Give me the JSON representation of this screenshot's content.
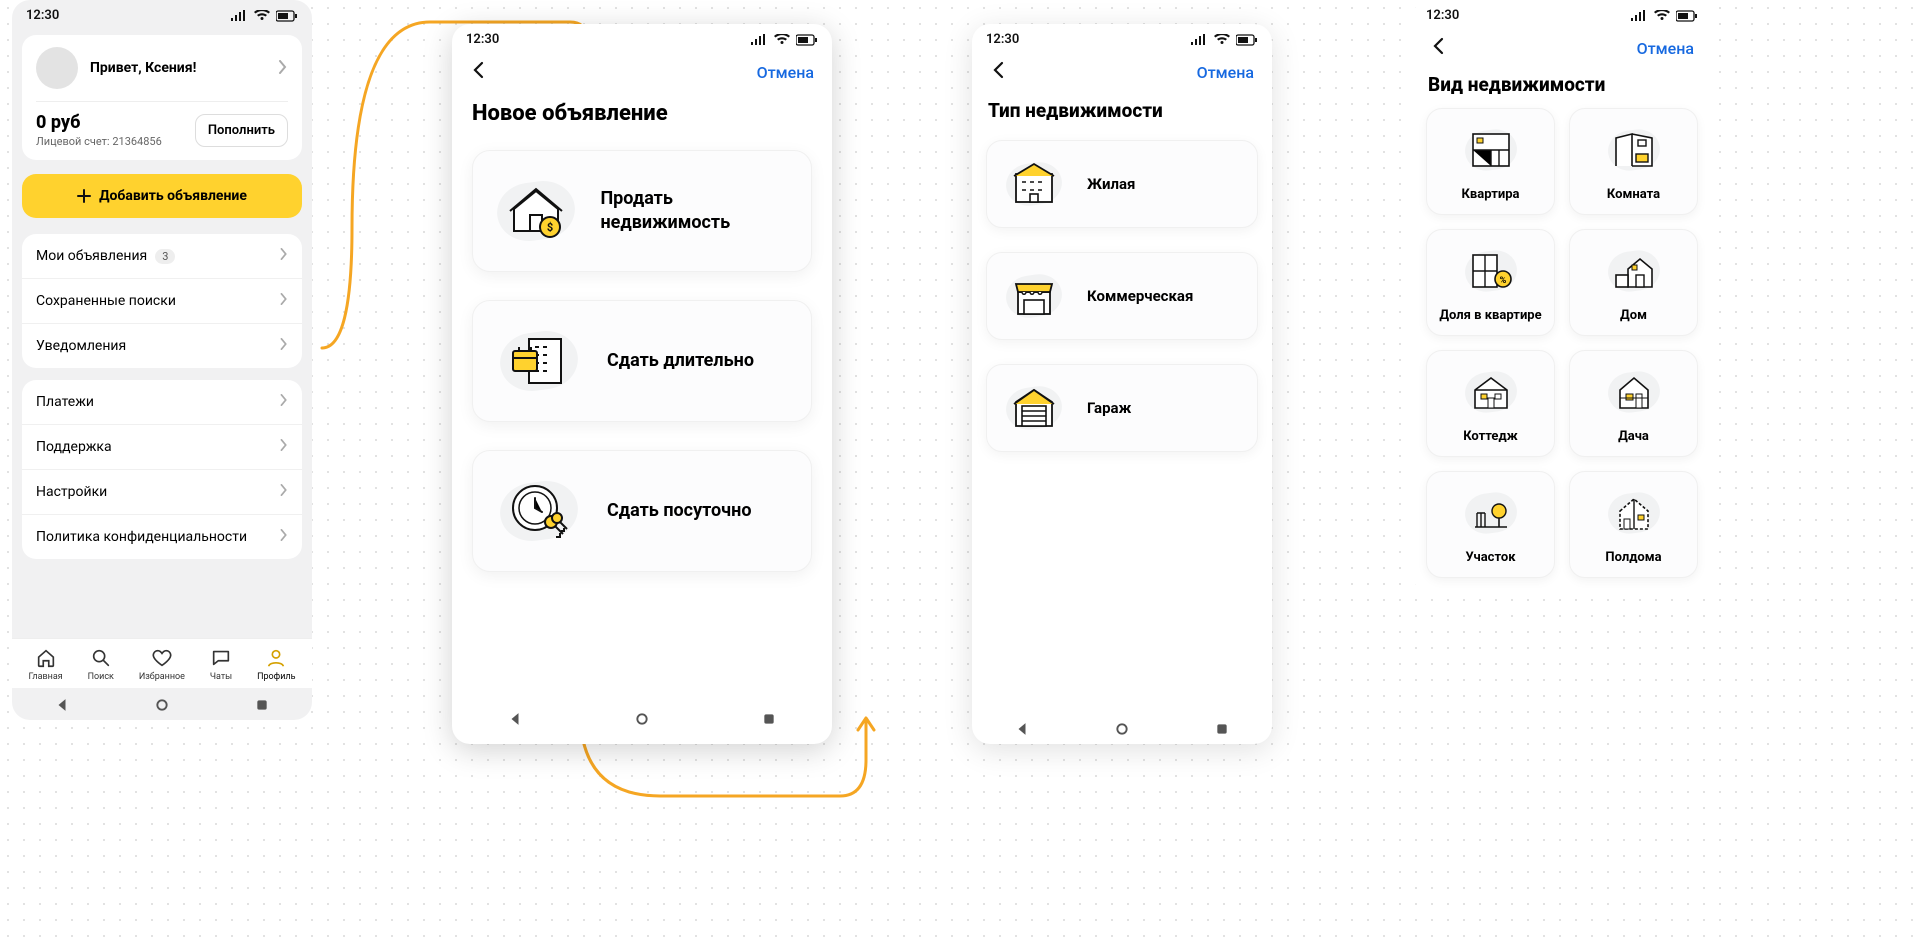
{
  "status": {
    "time": "12:30"
  },
  "screen1": {
    "greeting": "Привет, Ксения!",
    "balance": "0 руб",
    "account_label": "Лицевой счет: 21364856",
    "topup": "Пополнить",
    "add_listing": "Добавить объявление",
    "menu1": [
      {
        "label": "Мои объявления",
        "badge": "3"
      },
      {
        "label": "Сохраненные поиски"
      },
      {
        "label": "Уведомления"
      }
    ],
    "menu2": [
      {
        "label": "Платежи"
      },
      {
        "label": "Поддержка"
      },
      {
        "label": "Настройки"
      },
      {
        "label": "Политика конфиденциальности"
      }
    ],
    "tabs": [
      {
        "label": "Главная"
      },
      {
        "label": "Поиск"
      },
      {
        "label": "Избранное"
      },
      {
        "label": "Чаты"
      },
      {
        "label": "Профиль"
      }
    ]
  },
  "screen2": {
    "cancel": "Отмена",
    "title": "Новое объявление",
    "options": [
      {
        "label": "Продать недвижимость"
      },
      {
        "label": "Сдать длительно"
      },
      {
        "label": "Сдать посуточно"
      }
    ]
  },
  "screen3": {
    "cancel": "Отмена",
    "title": "Тип недвижимости",
    "options": [
      {
        "label": "Жилая"
      },
      {
        "label": "Коммерческая"
      },
      {
        "label": "Гараж"
      }
    ]
  },
  "screen4": {
    "cancel": "Отмена",
    "title": "Вид недвижимости",
    "tiles": [
      {
        "label": "Квартира"
      },
      {
        "label": "Комната"
      },
      {
        "label": "Доля в квартире"
      },
      {
        "label": "Дом"
      },
      {
        "label": "Коттедж"
      },
      {
        "label": "Дача"
      },
      {
        "label": "Участок"
      },
      {
        "label": "Полдома"
      }
    ]
  }
}
